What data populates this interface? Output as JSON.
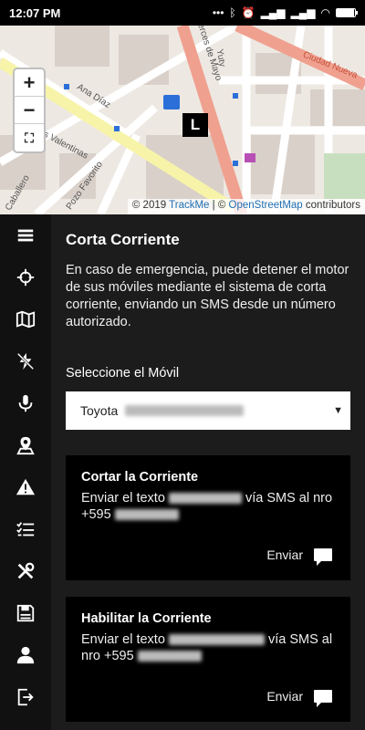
{
  "status_bar": {
    "time": "12:07 PM",
    "icons": [
      "dots-icon",
      "bluetooth-icon",
      "alarm-icon",
      "signal-icon",
      "signal-icon",
      "wifi-icon",
      "battery-icon"
    ],
    "battery_level": 0.95
  },
  "map": {
    "attribution_prefix": "© 2019",
    "attribution_trackme": "TrackMe",
    "attribution_sep": "| ©",
    "attribution_osm": "OpenStreetMap",
    "attribution_suffix": "contributors",
    "zoom_in": "+",
    "zoom_out": "−",
    "marker_label": "L",
    "street_labels": [
      "Ana Díaz",
      "Tomas Valentinas",
      "Pozo Favorito",
      "Caballero",
      "Yuty",
      "Cerces de Mayo",
      "Ciudad Nueva"
    ]
  },
  "sidebar": {
    "items": [
      {
        "icon": "menu-icon"
      },
      {
        "icon": "crosshair-icon"
      },
      {
        "icon": "map-icon"
      },
      {
        "icon": "power-cut-icon"
      },
      {
        "icon": "microphone-icon"
      },
      {
        "icon": "location-pin-icon"
      },
      {
        "icon": "warning-icon"
      },
      {
        "icon": "checklist-icon"
      },
      {
        "icon": "tools-icon"
      },
      {
        "icon": "save-icon"
      },
      {
        "icon": "user-icon"
      },
      {
        "icon": "logout-icon"
      }
    ]
  },
  "content": {
    "title": "Corta Corriente",
    "description": "En caso de emergencia, puede detener el motor de sus móviles mediante el sistema de corta corriente, enviando un SMS desde un número autorizado.",
    "select_label": "Seleccione el Móvil",
    "select_value": "Toyota",
    "cards": [
      {
        "title": "Cortar la Corriente",
        "text_prefix": "Enviar el texto",
        "text_middle": "vía SMS al nro +595",
        "send_label": "Enviar"
      },
      {
        "title": "Habilitar la Corriente",
        "text_prefix": "Enviar el texto",
        "text_middle": "vía SMS al nro +595",
        "send_label": "Enviar"
      }
    ]
  }
}
